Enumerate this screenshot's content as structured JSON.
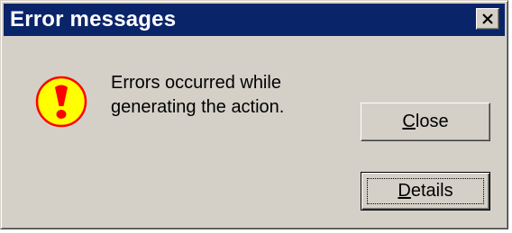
{
  "window": {
    "title": "Error messages",
    "titlebar_color": "#0a246a",
    "face_color": "#d4d0c8"
  },
  "titlebar": {
    "close_icon": "close-x-icon"
  },
  "dialog": {
    "icon": "exclamation-warning-icon",
    "icon_colors": {
      "fill": "#ffff00",
      "ring": "#ff0000",
      "mark": "#ff0000"
    },
    "message_line1": "Errors occurred while",
    "message_line2": "generating the action."
  },
  "buttons": {
    "close_mnemonic": "C",
    "close_rest": "lose",
    "details_mnemonic": "D",
    "details_rest": "etails"
  }
}
